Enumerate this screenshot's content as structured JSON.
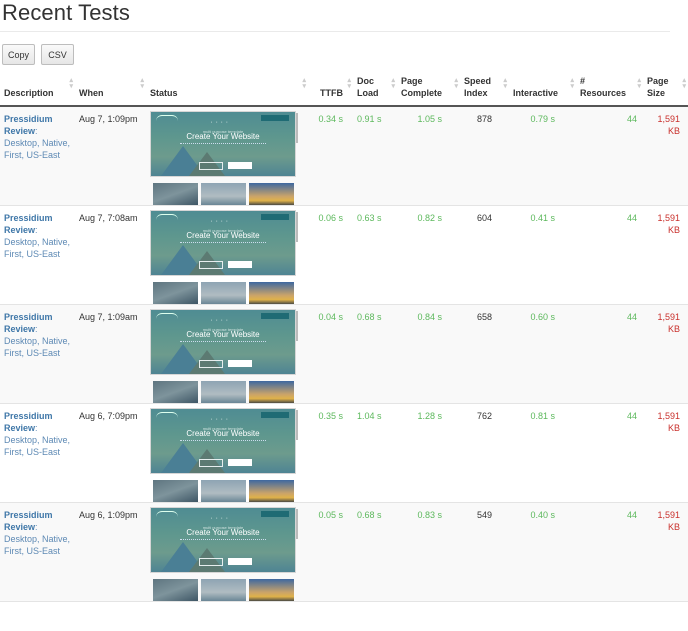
{
  "page": {
    "title": "Recent Tests"
  },
  "toolbar": {
    "copy_label": "Copy",
    "csv_label": "CSV"
  },
  "table": {
    "columns": [
      {
        "key": "description",
        "label": "Description"
      },
      {
        "key": "when",
        "label": "When"
      },
      {
        "key": "status",
        "label": "Status"
      },
      {
        "key": "ttfb",
        "label": "TTFB"
      },
      {
        "key": "doc_load",
        "label": "Doc Load"
      },
      {
        "key": "page_complete",
        "label": "Page Complete"
      },
      {
        "key": "speed_index",
        "label": "Speed Index"
      },
      {
        "key": "interactive",
        "label": "Interactive"
      },
      {
        "key": "resources",
        "label": "# Resources"
      },
      {
        "key": "page_size",
        "label": "Page Size"
      }
    ],
    "sort_icon": "sort-arrows-icon",
    "rows": [
      {
        "site": "Pressidium Review",
        "details": "Desktop, Native, First, US-East",
        "when": "Aug 7, 1:09pm",
        "status_thumbnail": "Create Your Website",
        "status_subtitle": "multi purpose template",
        "ttfb": "0.34 s",
        "doc_load": "0.91 s",
        "page_complete": "1.05 s",
        "speed_index": "878",
        "interactive": "0.79 s",
        "resources": "44",
        "page_size_value": "1,591",
        "page_size_unit": "KB"
      },
      {
        "site": "Pressidium Review",
        "details": "Desktop, Native, First, US-East",
        "when": "Aug 7, 7:08am",
        "status_thumbnail": "Create Your Website",
        "status_subtitle": "multi purpose template",
        "ttfb": "0.06 s",
        "doc_load": "0.63 s",
        "page_complete": "0.82 s",
        "speed_index": "604",
        "interactive": "0.41 s",
        "resources": "44",
        "page_size_value": "1,591",
        "page_size_unit": "KB"
      },
      {
        "site": "Pressidium Review",
        "details": "Desktop, Native, First, US-East",
        "when": "Aug 7, 1:09am",
        "status_thumbnail": "Create Your Website",
        "status_subtitle": "multi purpose template",
        "ttfb": "0.04 s",
        "doc_load": "0.68 s",
        "page_complete": "0.84 s",
        "speed_index": "658",
        "interactive": "0.60 s",
        "resources": "44",
        "page_size_value": "1,591",
        "page_size_unit": "KB"
      },
      {
        "site": "Pressidium Review",
        "details": "Desktop, Native, First, US-East",
        "when": "Aug 6, 7:09pm",
        "status_thumbnail": "Create Your Website",
        "status_subtitle": "multi purpose template",
        "ttfb": "0.35 s",
        "doc_load": "1.04 s",
        "page_complete": "1.28 s",
        "speed_index": "762",
        "interactive": "0.81 s",
        "resources": "44",
        "page_size_value": "1,591",
        "page_size_unit": "KB"
      },
      {
        "site": "Pressidium Review",
        "details": "Desktop, Native, First, US-East",
        "when": "Aug 6, 1:09pm",
        "status_thumbnail": "Create Your Website",
        "status_subtitle": "multi purpose template",
        "ttfb": "0.05 s",
        "doc_load": "0.68 s",
        "page_complete": "0.83 s",
        "speed_index": "549",
        "interactive": "0.40 s",
        "resources": "44",
        "page_size_value": "1,591",
        "page_size_unit": "KB"
      }
    ]
  },
  "colors": {
    "link": "#3f77a8",
    "good_metric": "#5cb85c",
    "bad_metric": "#c9302c",
    "text": "#333333"
  }
}
